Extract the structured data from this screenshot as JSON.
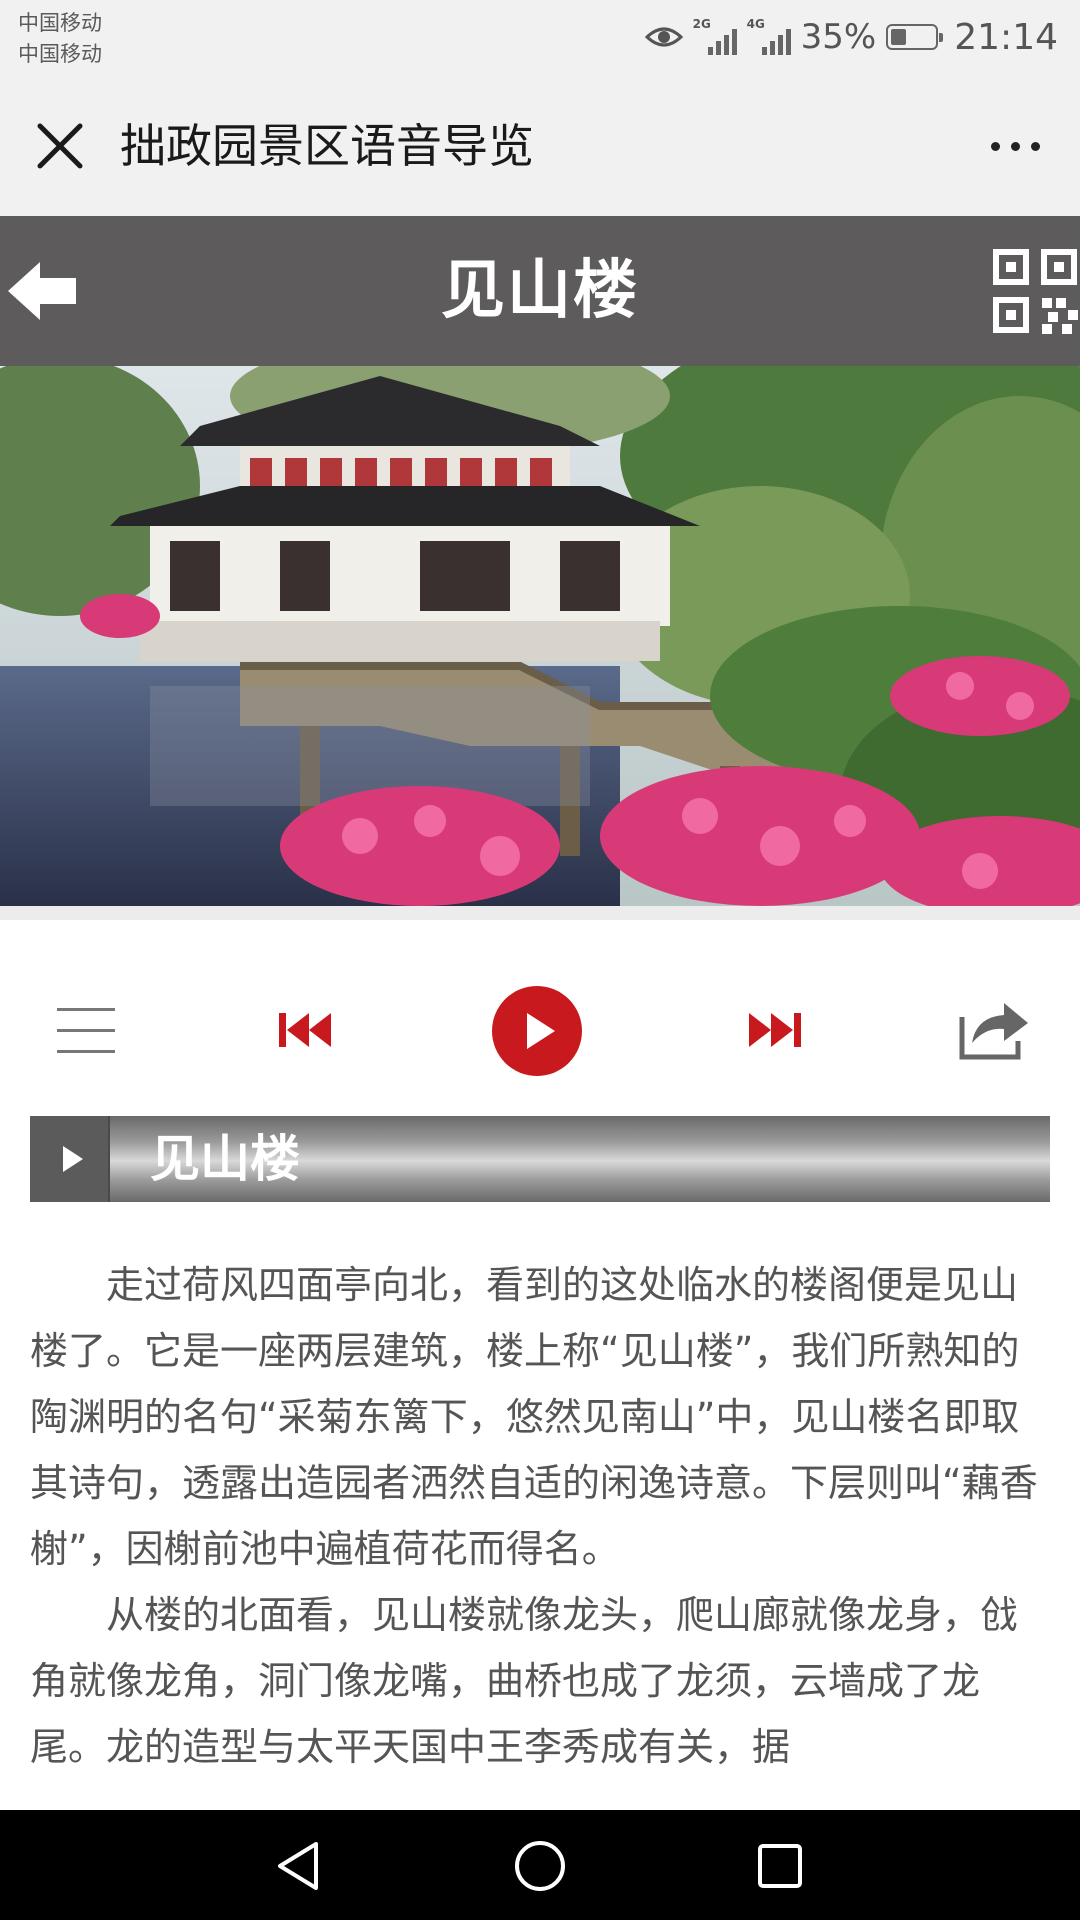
{
  "status_bar": {
    "carrier_1": "中国移动",
    "carrier_2": "中国移动",
    "sim1_network": "2G",
    "sim2_network": "4G",
    "battery_percent_text": "35%",
    "battery_level": 0.35,
    "time": "21:14",
    "icons": [
      "eye-icon",
      "signal-icon",
      "battery-icon"
    ]
  },
  "titlebar": {
    "title": "拙政园景区语音导览",
    "close_icon": "close-icon",
    "more_icon": "more-dots-icon"
  },
  "page_header": {
    "title": "见山楼",
    "back_icon": "back-arrow-icon",
    "qr_icon": "qr-code-icon",
    "background": "#5d5b5c"
  },
  "player": {
    "accent": "#c8191e",
    "controls": [
      "playlist-icon",
      "previous-icon",
      "play-icon",
      "next-icon",
      "share-icon"
    ]
  },
  "section": {
    "title": "见山楼"
  },
  "article": {
    "paragraphs": [
      "走过荷风四面亭向北，看到的这处临水的楼阁便是见山楼了。它是一座两层建筑，楼上称“见山楼”，我们所熟知的陶渊明的名句“采菊东篱下，悠然见南山”中，见山楼名即取其诗句，透露出造园者洒然自适的闲逸诗意。下层则叫“藕香榭”，因榭前池中遍植荷花而得名。",
      "从楼的北面看，见山楼就像龙头，爬山廊就像龙身，戗角就像龙角，洞门像龙嘴，曲桥也成了龙须，云墙成了龙尾。龙的造型与太平天国中王李秀成有关，据"
    ]
  },
  "nav_bar": {
    "buttons": [
      "back-triangle-icon",
      "home-circle-icon",
      "recents-square-icon"
    ]
  }
}
